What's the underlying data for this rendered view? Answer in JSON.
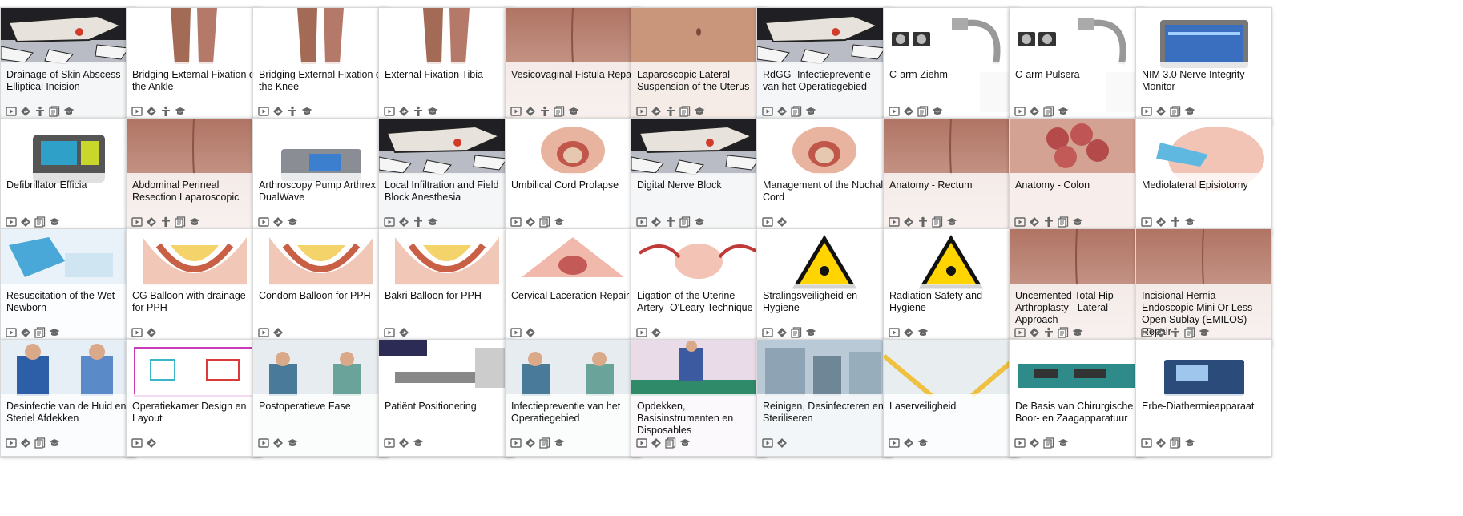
{
  "cards": [
    {
      "title": "Drainage of Skin Abscess – Elliptical Incision",
      "thumb": "cartoon",
      "icons": [
        "video",
        "diamond",
        "person",
        "docs",
        "cap"
      ]
    },
    {
      "title": "Bridging External Fixation of the Ankle",
      "thumb": "legs",
      "icons": [
        "video",
        "diamond",
        "person",
        "cap"
      ]
    },
    {
      "title": "Bridging External Fixation of the Knee",
      "thumb": "legs",
      "icons": [
        "video",
        "diamond",
        "person",
        "cap"
      ]
    },
    {
      "title": "External Fixation Tibia",
      "thumb": "legs",
      "icons": [
        "video",
        "diamond",
        "person",
        "cap"
      ]
    },
    {
      "title": "Vesicovaginal Fistula Repair",
      "thumb": "skin",
      "icons": [
        "video",
        "diamond",
        "person",
        "docs",
        "cap"
      ]
    },
    {
      "title": "Laparoscopic Lateral Suspension of the Uterus",
      "thumb": "belly",
      "icons": [
        "video",
        "diamond",
        "person",
        "docs",
        "cap"
      ]
    },
    {
      "title": "RdGG- Infectiepreventie van het Operatiegebied",
      "thumb": "cartoon",
      "icons": [
        "video",
        "diamond",
        "docs",
        "cap"
      ]
    },
    {
      "title": "C-arm Ziehm",
      "thumb": "carm",
      "icons": [
        "video",
        "diamond",
        "docs",
        "cap"
      ]
    },
    {
      "title": "C-arm Pulsera",
      "thumb": "carm",
      "icons": [
        "video",
        "diamond",
        "docs",
        "cap"
      ]
    },
    {
      "title": "NIM 3.0 Nerve Integrity Monitor",
      "thumb": "monitor",
      "icons": [
        "video",
        "diamond",
        "docs",
        "cap"
      ]
    },
    {
      "title": "Defibrillator Efficia",
      "thumb": "device",
      "icons": [
        "video",
        "diamond",
        "docs",
        "cap"
      ]
    },
    {
      "title": "Abdominal Perineal Resection Laparoscopic",
      "thumb": "skin",
      "icons": [
        "video",
        "diamond",
        "person",
        "docs",
        "cap"
      ]
    },
    {
      "title": "Arthroscopy Pump Arthrex DualWave",
      "thumb": "pump",
      "icons": [
        "video",
        "diamond",
        "cap"
      ]
    },
    {
      "title": "Local Infiltration and Field Block Anesthesia",
      "thumb": "cartoon",
      "icons": [
        "video",
        "diamond",
        "person",
        "cap"
      ]
    },
    {
      "title": "Umbilical Cord Prolapse",
      "thumb": "birth",
      "icons": [
        "video",
        "diamond",
        "docs",
        "cap"
      ]
    },
    {
      "title": "Digital Nerve Block",
      "thumb": "cartoon",
      "icons": [
        "video",
        "diamond",
        "person",
        "docs",
        "cap"
      ]
    },
    {
      "title": "Management of the Nuchal Cord",
      "thumb": "birth",
      "icons": [
        "video",
        "diamond"
      ]
    },
    {
      "title": "Anatomy - Rectum",
      "thumb": "skin",
      "icons": [
        "video",
        "diamond",
        "person",
        "docs",
        "cap"
      ]
    },
    {
      "title": "Anatomy - Colon",
      "thumb": "colon",
      "icons": [
        "video",
        "diamond",
        "person",
        "docs",
        "cap"
      ]
    },
    {
      "title": "Mediolateral Episiotomy",
      "thumb": "episiotomy",
      "icons": [
        "video",
        "diamond",
        "person",
        "cap"
      ]
    },
    {
      "title": "Resuscitation of the Wet Newborn",
      "thumb": "gloves",
      "icons": [
        "video",
        "diamond",
        "docs",
        "cap"
      ]
    },
    {
      "title": "CG Balloon with drainage for PPH",
      "thumb": "uterus",
      "icons": [
        "video",
        "diamond"
      ]
    },
    {
      "title": "Condom Balloon for PPH",
      "thumb": "uterus",
      "icons": [
        "video",
        "diamond"
      ]
    },
    {
      "title": "Bakri Balloon for PPH",
      "thumb": "uterus",
      "icons": [
        "video",
        "diamond"
      ]
    },
    {
      "title": "Cervical Laceration Repair",
      "thumb": "cervix",
      "icons": [
        "video",
        "diamond"
      ]
    },
    {
      "title": "Ligation of the Uterine Artery -O'Leary Technique",
      "thumb": "anatomy",
      "icons": [
        "video",
        "diamond"
      ]
    },
    {
      "title": "Stralingsveiligheid en Hygiene",
      "thumb": "radiation",
      "icons": [
        "video",
        "diamond",
        "docs",
        "cap"
      ]
    },
    {
      "title": "Radiation Safety and Hygiene",
      "thumb": "radiation",
      "icons": [
        "video",
        "diamond",
        "cap"
      ]
    },
    {
      "title": "Uncemented Total Hip Arthroplasty - Lateral Approach",
      "thumb": "skin",
      "icons": [
        "video",
        "diamond",
        "person",
        "docs",
        "cap"
      ]
    },
    {
      "title": "Incisional Hernia - Endoscopic Mini Or Less-Open Sublay (EMILOS) Repair",
      "thumb": "skin",
      "icons": [
        "video",
        "diamond",
        "person",
        "docs",
        "cap"
      ]
    },
    {
      "title": "Desinfectie van de Huid en Steriel Afdekken",
      "thumb": "surgeons",
      "icons": [
        "video",
        "diamond",
        "docs",
        "cap"
      ]
    },
    {
      "title": "Operatiekamer Design en Layout",
      "thumb": "floorplan",
      "icons": [
        "video",
        "diamond"
      ]
    },
    {
      "title": "Postoperatieve Fase",
      "thumb": "nurses",
      "icons": [
        "video",
        "diamond",
        "cap"
      ]
    },
    {
      "title": "Patiënt Positionering",
      "thumb": "table",
      "icons": [
        "video",
        "diamond",
        "cap"
      ]
    },
    {
      "title": "Infectiepreventie van het Operatiegebied",
      "thumb": "nurses",
      "icons": [
        "video",
        "diamond",
        "docs",
        "cap"
      ]
    },
    {
      "title": "Opdekken, Basisinstrumenten en Disposables",
      "thumb": "purple",
      "icons": [
        "video",
        "diamond",
        "docs",
        "cap"
      ]
    },
    {
      "title": "Reinigen, Desinfecteren en Steriliseren",
      "thumb": "steril",
      "icons": [
        "video",
        "diamond"
      ]
    },
    {
      "title": "Laserveiligheid",
      "thumb": "laser",
      "icons": [
        "video",
        "diamond",
        "cap"
      ]
    },
    {
      "title": "De Basis van Chirurgische Boor- en Zaagapparatuur",
      "thumb": "drill",
      "icons": [
        "video",
        "diamond",
        "docs",
        "cap"
      ]
    },
    {
      "title": "Erbe-Diathermieapparaat",
      "thumb": "erbe",
      "icons": [
        "video",
        "diamond",
        "docs",
        "cap"
      ]
    }
  ]
}
